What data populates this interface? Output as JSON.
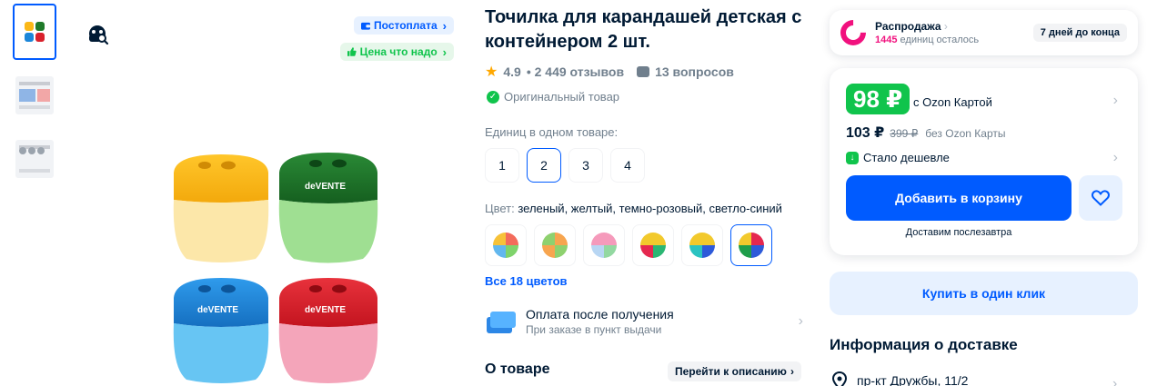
{
  "gallery": {
    "thumbnails": [
      {
        "kind": "product-set",
        "active": true
      },
      {
        "kind": "info-card",
        "active": false
      },
      {
        "kind": "info-card",
        "active": false
      }
    ],
    "badges": {
      "postpay": "Постоплата",
      "good_price": "Цена что надо"
    },
    "main_image": {
      "brand_text": "deVENTE",
      "colors": [
        "#fbb817",
        "#1f7a2a",
        "#1b86d9",
        "#d9212c"
      ]
    }
  },
  "product": {
    "title": "Точилка для карандашей детская с контейнером 2 шт.",
    "rating": "4.9",
    "reviews": "• 2 449 отзывов",
    "questions": "13 вопросов",
    "original": "Оригинальный товар",
    "units_label": "Единиц в одном товаре:",
    "units": [
      "1",
      "2",
      "3",
      "4"
    ],
    "units_selected": 1,
    "color_label_prefix": "Цвет: ",
    "color_value": "зеленый, желтый, темно-розовый, светло-синий",
    "swatches": [
      {
        "colors": [
          "#f36b5b",
          "#7fd36b",
          "#62b7ee",
          "#f7c238"
        ]
      },
      {
        "colors": [
          "#f7a54f",
          "#8ed16f",
          "#f7a54f",
          "#8ed16f"
        ]
      },
      {
        "colors": [
          "#f59abb",
          "#93d8a1",
          "#b8d6f3",
          "#f59abb"
        ]
      },
      {
        "colors": [
          "#f2c92c",
          "#2bb673",
          "#e5284f",
          "#f2c92c"
        ]
      },
      {
        "colors": [
          "#f2c92c",
          "#2d5ad9",
          "#2bc3c1",
          "#f2c92c"
        ]
      },
      {
        "colors": [
          "#e5284f",
          "#2d5ad9",
          "#1f9d4a",
          "#f2c92c"
        ]
      }
    ],
    "swatch_selected": 5,
    "all_colors": "Все 18 цветов",
    "pay_after_title": "Оплата после получения",
    "pay_after_sub": "При заказе в пункт выдачи",
    "about_title": "О товаре",
    "goto_description": "Перейти к описанию"
  },
  "sale": {
    "title": "Распродажа",
    "count": "1445",
    "count_suffix": " единиц осталось",
    "days_left": "7 дней до конца"
  },
  "price": {
    "ozon_price": "98 ₽",
    "ozon_label": "с Ozon Картой",
    "regular_price": "103 ₽",
    "old_price": "399 ₽",
    "regular_label": "без Ozon Карты",
    "cheaper": "Стало дешевле",
    "add_to_cart": "Добавить в корзину",
    "delivery_note": "Доставим послезавтра"
  },
  "buy_one_click": "Купить в один клик",
  "delivery": {
    "title": "Информация о доставке",
    "address": "пр-кт Дружбы, 11/2"
  },
  "colors": {
    "accent": "#005bff",
    "green": "#10c44c",
    "pink": "#f1117e"
  }
}
